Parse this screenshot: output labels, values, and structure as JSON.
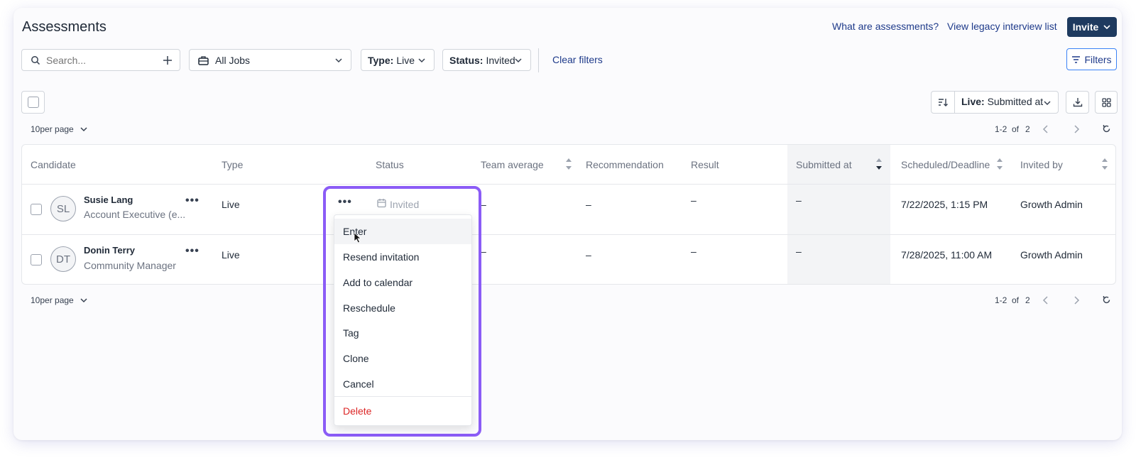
{
  "header": {
    "title": "Assessments",
    "what_link": "What are assessments?",
    "legacy_link": "View legacy interview list",
    "invite_label": "Invite"
  },
  "filters": {
    "search_placeholder": "Search...",
    "jobs_value": "All Jobs",
    "type_label": "Type:",
    "type_value": "Live",
    "status_label": "Status:",
    "status_value": "Invited",
    "clear_label": "Clear filters",
    "filters_button": "Filters"
  },
  "toolbar": {
    "sort_label": "Live:",
    "sort_value": "Submitted at"
  },
  "pagination": {
    "per_page_top": "10per page",
    "per_page_bottom": "10per page",
    "range": "1-2",
    "of_label": "of",
    "total": "2"
  },
  "table": {
    "columns": [
      "Candidate",
      "Type",
      "Status",
      "Team average",
      "Recommendation",
      "Result",
      "Submitted at",
      "Scheduled/Deadline",
      "Invited by"
    ],
    "rows": [
      {
        "initials": "SL",
        "name": "Susie Lang",
        "role": "Account Executive (e...",
        "type": "Live",
        "status": "Invited",
        "team_average": "–",
        "recommendation": "–",
        "result": "–",
        "submitted_at": "–",
        "scheduled": "7/22/2025, 1:15 PM",
        "invited_by": "Growth Admin"
      },
      {
        "initials": "DT",
        "name": "Donin Terry",
        "role": "Community Manager",
        "type": "Live",
        "status": "",
        "team_average": "–",
        "recommendation": "–",
        "result": "–",
        "submitted_at": "–",
        "scheduled": "7/28/2025, 11:00 AM",
        "invited_by": "Growth Admin"
      }
    ]
  },
  "menu": {
    "items": [
      "Enter",
      "Resend invitation",
      "Add to calendar",
      "Reschedule",
      "Tag",
      "Clone",
      "Cancel"
    ],
    "delete": "Delete"
  },
  "colors": {
    "accent": "#1e3a5f",
    "link": "#1e3a8a",
    "highlight": "#8b5cf6",
    "danger": "#dc2626"
  },
  "icons": [
    "search-icon",
    "plus-icon",
    "briefcase-icon",
    "chevron-down-icon",
    "filter-icon",
    "sort-icon",
    "download-icon",
    "grid-icon",
    "chevron-left-icon",
    "chevron-right-icon",
    "refresh-icon",
    "calendar-icon",
    "more-icon",
    "cursor-icon"
  ]
}
